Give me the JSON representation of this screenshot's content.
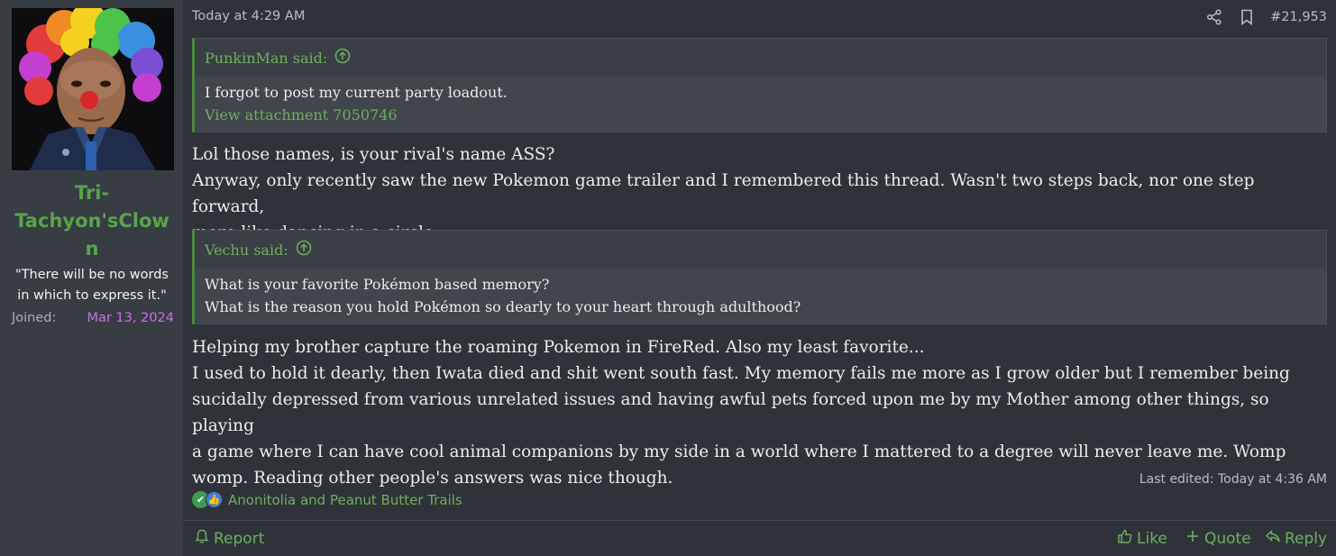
{
  "user": {
    "name": "Tri-Tachyon'sClown",
    "name_lines": [
      "Tri-",
      "Tachyon'sClow",
      "n"
    ],
    "title_lines": [
      "\"There will be no words",
      "in which to express it.\""
    ],
    "joined_label": "Joined:",
    "joined_date": "Mar 13, 2024"
  },
  "post": {
    "date": "Today at 4:29 AM",
    "number": "#21,953",
    "quote1": {
      "author": "PunkinMan said:",
      "line1": "I forgot to post my current party loadout.",
      "attachment": "View attachment 7050746"
    },
    "text1": {
      "line1": "Lol those names, is your rival's name ASS?",
      "line2": "Anyway, only recently saw the new Pokemon game trailer and I remembered this thread. Wasn't two steps back, nor one step forward,",
      "line3": "more like dancing in a circle."
    },
    "quote2": {
      "author": "Vechu said:",
      "line1": "What is your favorite Pokémon based memory?",
      "line2": "What is the reason you hold Pokémon so dearly to your heart through adulthood?"
    },
    "text2": {
      "line1": "Helping my brother capture the roaming Pokemon in FireRed. Also my least favorite...",
      "line2": "I used to hold it dearly, then Iwata died and shit went south fast. My memory fails me more as I grow older but I remember being",
      "line3": "sucidally depressed from various unrelated issues and having awful pets forced upon me by my Mother among other things, so playing",
      "line4": "a game where I can have cool animal companions by my side in a world where I mattered to a degree will never leave me. Womp",
      "line5": "womp. Reading other people's answers was nice though."
    },
    "last_edited": "Last edited: Today at 4:36 AM",
    "reactions": "Anonitolia and Peanut Butter Trails"
  },
  "actions": {
    "report": "Report",
    "like": "Like",
    "quote": "Quote",
    "reply": "Reply"
  },
  "colors": {
    "accent_green": "#6fae5f",
    "username_green": "#5aa34b",
    "joined_purple": "#c86fe7"
  },
  "icons": [
    "share-icon",
    "bookmark-icon",
    "quote-arrow-up-icon",
    "check-reaction-icon",
    "like-reaction-icon",
    "bell-icon",
    "thumbs-up-icon",
    "plus-icon",
    "reply-arrow-icon"
  ]
}
